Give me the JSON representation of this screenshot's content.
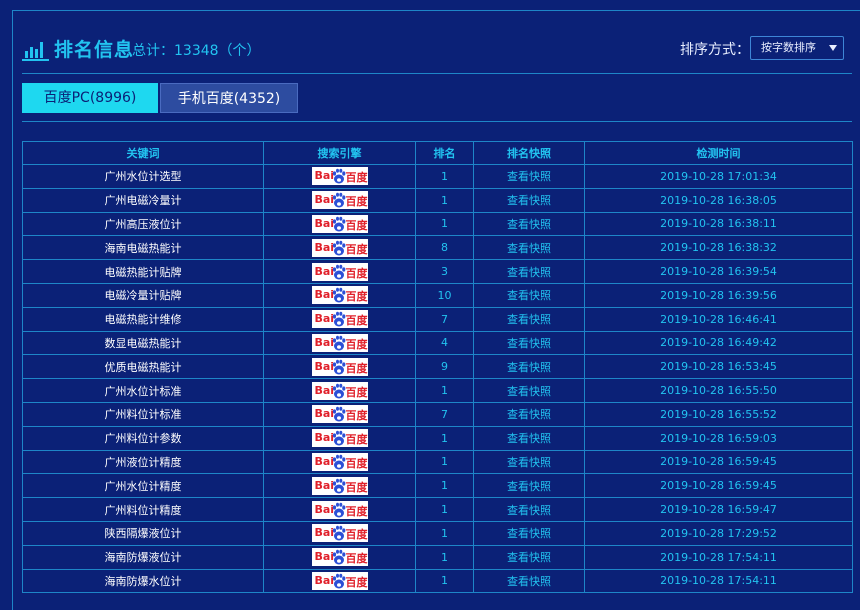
{
  "header": {
    "title": "排名信息",
    "total_text": "总计：13348（个）",
    "sort_label": "排序方式：",
    "sort_value": "按字数排序"
  },
  "tabs": [
    {
      "label": "百度PC(8996)",
      "active": true
    },
    {
      "label": "手机百度(4352)",
      "active": false
    }
  ],
  "table": {
    "columns": [
      "关键词",
      "搜索引擎",
      "排名",
      "排名快照",
      "检测时间"
    ],
    "engine_logo": {
      "text_left": "Bai",
      "text_right": "百度",
      "icon": "baidu-paw-icon"
    },
    "rows": [
      {
        "keyword": "广州水位计选型",
        "rank": "1",
        "snapshot": "查看快照",
        "time": "2019-10-28 17:01:34"
      },
      {
        "keyword": "广州电磁冷量计",
        "rank": "1",
        "snapshot": "查看快照",
        "time": "2019-10-28 16:38:05"
      },
      {
        "keyword": "广州高压液位计",
        "rank": "1",
        "snapshot": "查看快照",
        "time": "2019-10-28 16:38:11"
      },
      {
        "keyword": "海南电磁热能计",
        "rank": "8",
        "snapshot": "查看快照",
        "time": "2019-10-28 16:38:32"
      },
      {
        "keyword": "电磁热能计贴牌",
        "rank": "3",
        "snapshot": "查看快照",
        "time": "2019-10-28 16:39:54"
      },
      {
        "keyword": "电磁冷量计贴牌",
        "rank": "10",
        "snapshot": "查看快照",
        "time": "2019-10-28 16:39:56"
      },
      {
        "keyword": "电磁热能计维修",
        "rank": "7",
        "snapshot": "查看快照",
        "time": "2019-10-28 16:46:41"
      },
      {
        "keyword": "数显电磁热能计",
        "rank": "4",
        "snapshot": "查看快照",
        "time": "2019-10-28 16:49:42"
      },
      {
        "keyword": "优质电磁热能计",
        "rank": "9",
        "snapshot": "查看快照",
        "time": "2019-10-28 16:53:45"
      },
      {
        "keyword": "广州水位计标准",
        "rank": "1",
        "snapshot": "查看快照",
        "time": "2019-10-28 16:55:50"
      },
      {
        "keyword": "广州料位计标准",
        "rank": "7",
        "snapshot": "查看快照",
        "time": "2019-10-28 16:55:52"
      },
      {
        "keyword": "广州料位计参数",
        "rank": "1",
        "snapshot": "查看快照",
        "time": "2019-10-28 16:59:03"
      },
      {
        "keyword": "广州液位计精度",
        "rank": "1",
        "snapshot": "查看快照",
        "time": "2019-10-28 16:59:45"
      },
      {
        "keyword": "广州水位计精度",
        "rank": "1",
        "snapshot": "查看快照",
        "time": "2019-10-28 16:59:45"
      },
      {
        "keyword": "广州料位计精度",
        "rank": "1",
        "snapshot": "查看快照",
        "time": "2019-10-28 16:59:47"
      },
      {
        "keyword": "陕西隔爆液位计",
        "rank": "1",
        "snapshot": "查看快照",
        "time": "2019-10-28 17:29:52"
      },
      {
        "keyword": "海南防爆液位计",
        "rank": "1",
        "snapshot": "查看快照",
        "time": "2019-10-28 17:54:11"
      },
      {
        "keyword": "海南防爆水位计",
        "rank": "1",
        "snapshot": "查看快照",
        "time": "2019-10-28 17:54:11"
      }
    ]
  },
  "colors": {
    "background": "#0b2177",
    "accent": "#22c3f0",
    "border": "#1e86c8",
    "tab_active": "#1ed8f0",
    "tab_inactive": "#2d4ca0"
  }
}
